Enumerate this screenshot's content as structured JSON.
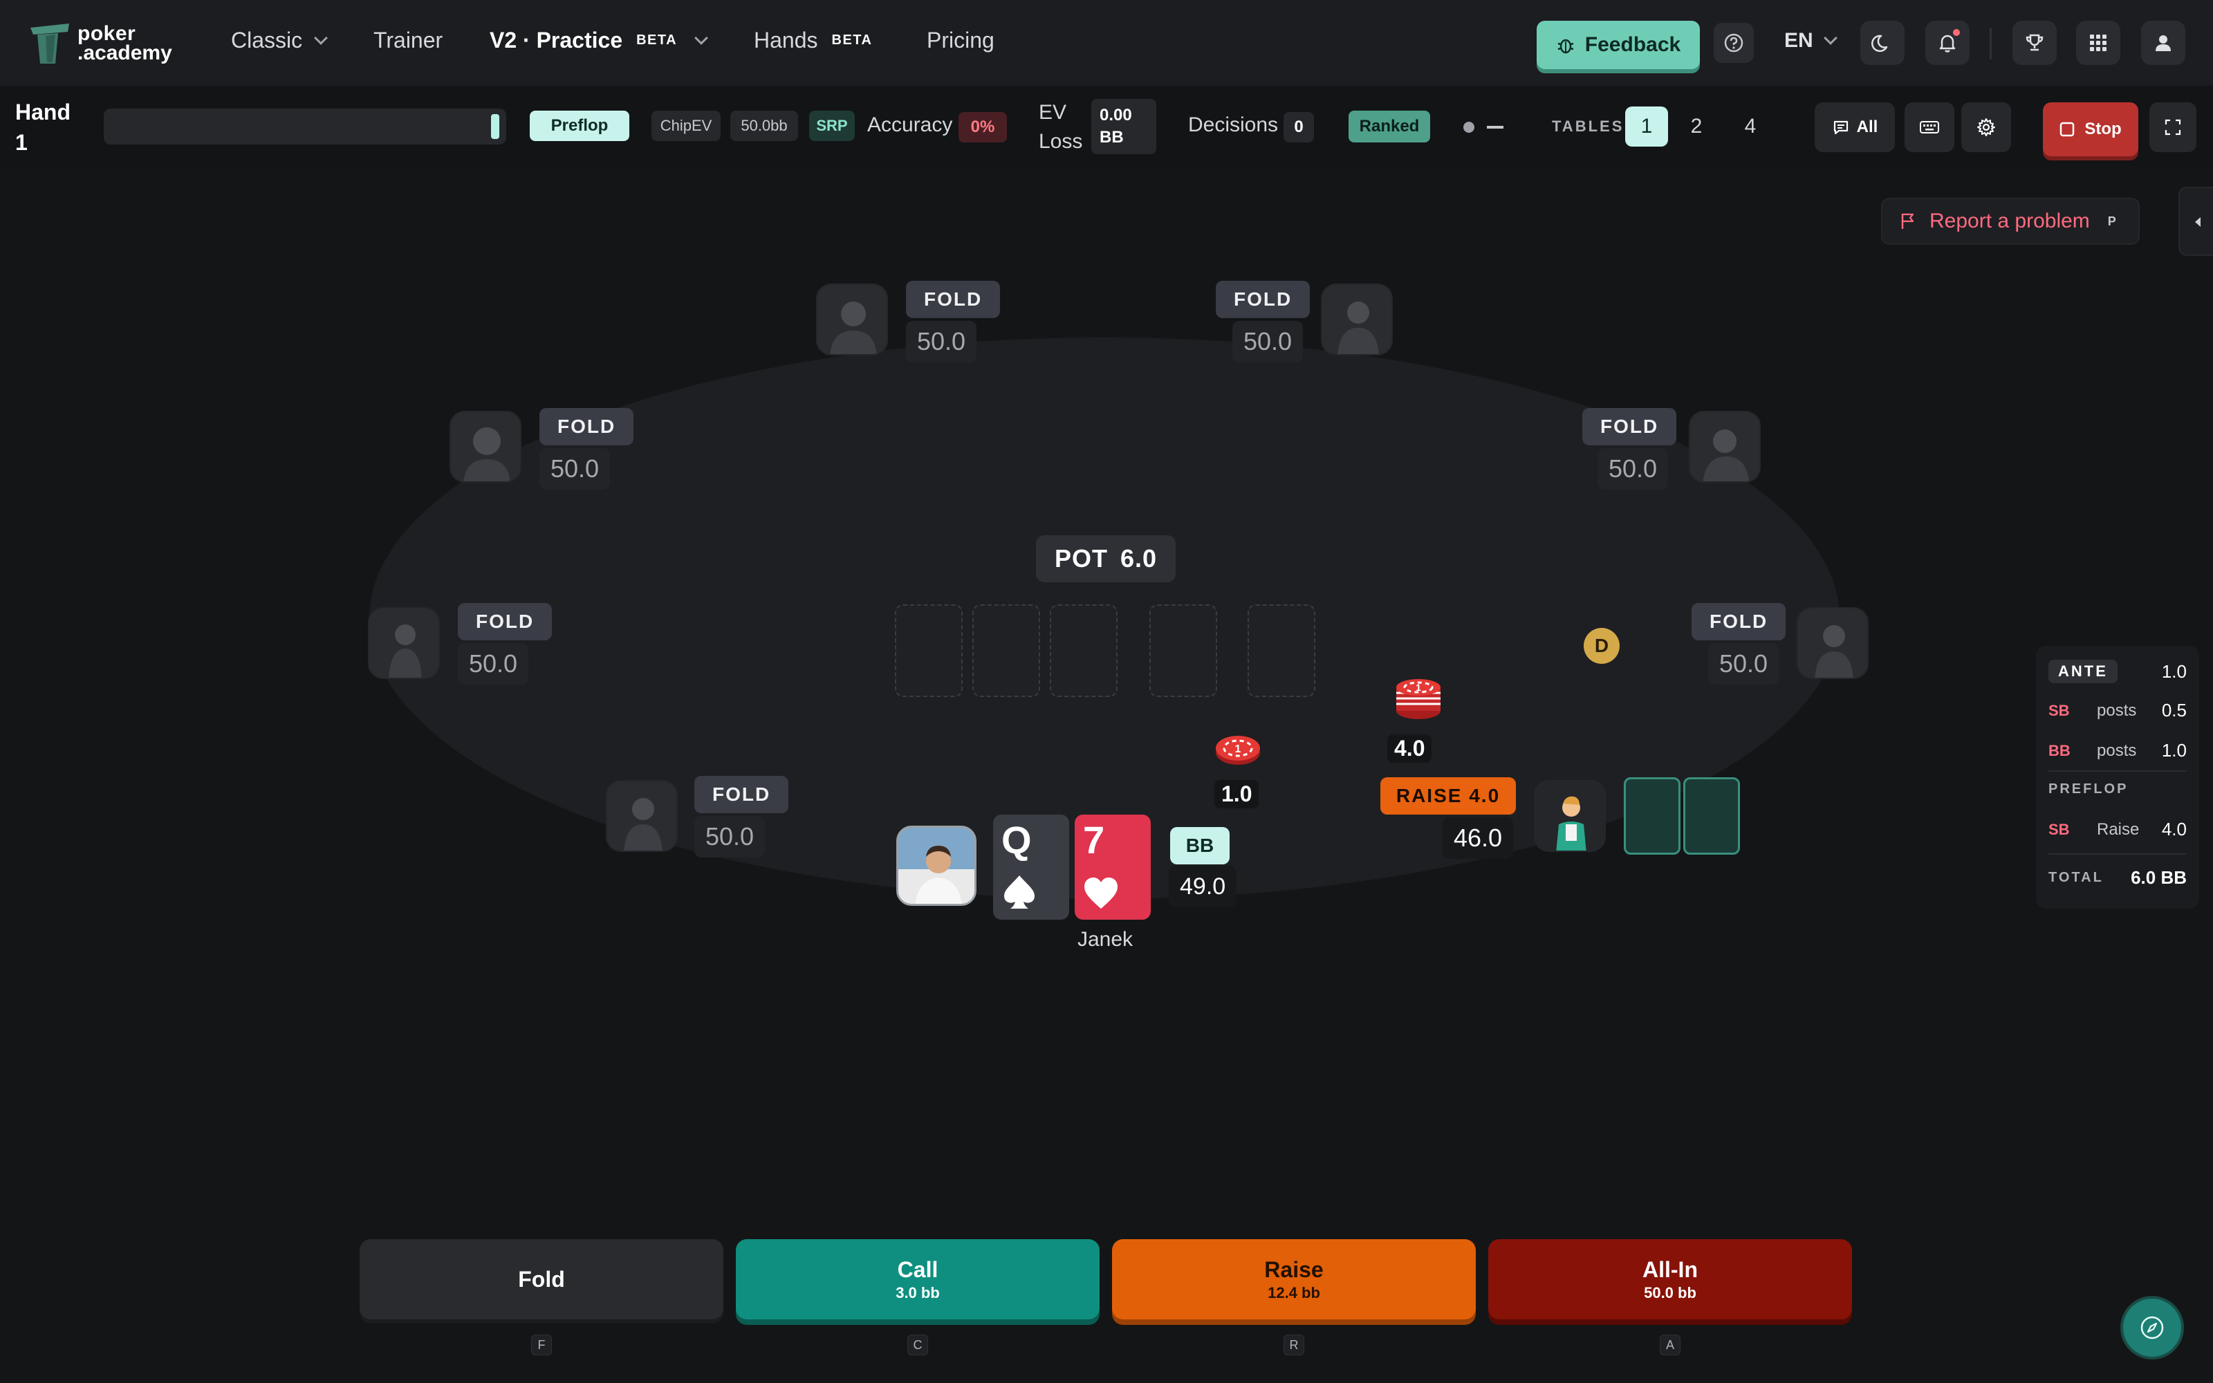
{
  "app": {
    "logo_line1": "poker",
    "logo_line2": ".academy"
  },
  "nav": {
    "classic": "Classic",
    "trainer": "Trainer",
    "practice": "V2 · Practice",
    "practice_badge": "BETA",
    "hands": "Hands",
    "hands_badge": "BETA",
    "pricing": "Pricing",
    "feedback": "Feedback",
    "language": "EN"
  },
  "toolbar": {
    "hand_label": "Hand",
    "hand_number": "1",
    "street": "Preflop",
    "mode_chip": "ChipEV",
    "stack_chip": "50.0bb",
    "pot_type_chip": "SRP",
    "accuracy_label": "Accuracy",
    "accuracy_value": "0%",
    "ev_loss_label_1": "EV",
    "ev_loss_label_2": "Loss",
    "ev_loss_value_1": "0.00",
    "ev_loss_value_2": "BB",
    "decisions_label": "Decisions",
    "decisions_value": "0",
    "ranked": "Ranked",
    "tables_label": "TABLES",
    "tables": [
      "1",
      "2",
      "4"
    ],
    "tables_active": "1",
    "filter_all": "All",
    "stop": "Stop"
  },
  "table": {
    "report_problem": "Report a problem",
    "report_hotkey": "P",
    "pot_label": "POT",
    "pot_value": "6.0",
    "dealer": "D",
    "seats": [
      {
        "id": "top-left",
        "action": "FOLD",
        "stack": "50.0"
      },
      {
        "id": "top-right",
        "action": "FOLD",
        "stack": "50.0"
      },
      {
        "id": "upper-left",
        "action": "FOLD",
        "stack": "50.0"
      },
      {
        "id": "upper-right",
        "action": "FOLD",
        "stack": "50.0"
      },
      {
        "id": "mid-left",
        "action": "FOLD",
        "stack": "50.0"
      },
      {
        "id": "mid-right",
        "action": "FOLD",
        "stack": "50.0"
      },
      {
        "id": "lower-left",
        "action": "FOLD",
        "stack": "50.0"
      }
    ],
    "villain": {
      "action": "RAISE 4.0",
      "stack": "46.0",
      "bet": "4.0"
    },
    "hero": {
      "name": "Janek",
      "position": "BB",
      "stack": "49.0",
      "bet": "1.0",
      "cards": [
        {
          "rank": "Q",
          "suit": "spades",
          "color": "#3b3d44"
        },
        {
          "rank": "7",
          "suit": "hearts",
          "color": "#e0344f"
        }
      ]
    }
  },
  "action_log": {
    "ante_label": "ANTE",
    "ante_value": "1.0",
    "rows_blinds": [
      {
        "pos": "SB",
        "action": "posts",
        "value": "0.5"
      },
      {
        "pos": "BB",
        "action": "posts",
        "value": "1.0"
      }
    ],
    "preflop_label": "PREFLOP",
    "rows_preflop": [
      {
        "pos": "SB",
        "action": "Raise",
        "value": "4.0"
      }
    ],
    "total_label": "TOTAL",
    "total_value": "6.0 BB"
  },
  "actions": {
    "fold": {
      "label": "Fold",
      "hotkey": "F"
    },
    "call": {
      "label": "Call",
      "sub": "3.0 bb",
      "hotkey": "C"
    },
    "raise": {
      "label": "Raise",
      "sub": "12.4 bb",
      "hotkey": "R"
    },
    "allin": {
      "label": "All-In",
      "sub": "50.0 bb",
      "hotkey": "A"
    }
  },
  "colors": {
    "accent_teal": "#6fcdb6",
    "call": "#0f8f7f",
    "raise": "#e26008",
    "allin": "#871208",
    "stop": "#b9322e"
  }
}
